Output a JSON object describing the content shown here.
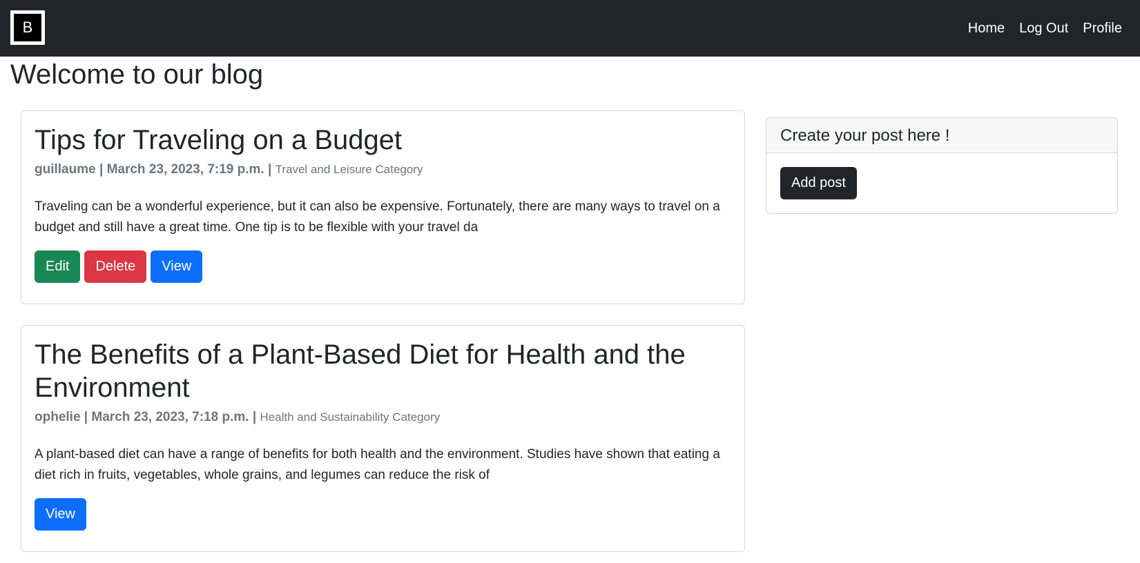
{
  "navbar": {
    "brand_letter": "B",
    "links": [
      "Home",
      "Log Out",
      "Profile"
    ]
  },
  "page": {
    "title": "Welcome to our blog"
  },
  "posts": [
    {
      "title": "Tips for Traveling on a Budget",
      "author": "guillaume",
      "date": "March 23, 2023, 7:19 p.m.",
      "separator": "|",
      "category": "Travel and Leisure Category",
      "excerpt": "Traveling can be a wonderful experience, but it can also be expensive. Fortunately, there are many ways to travel on a budget and still have a great time. One tip is to be flexible with your travel da",
      "buttons": {
        "edit": "Edit",
        "delete": "Delete",
        "view": "View"
      }
    },
    {
      "title": "The Benefits of a Plant-Based Diet for Health and the Environment",
      "author": "ophelie",
      "date": "March 23, 2023, 7:18 p.m.",
      "separator": "|",
      "category": "Health and Sustainability Category",
      "excerpt": "A plant-based diet can have a range of benefits for both health and the environment. Studies have shown that eating a diet rich in fruits, vegetables, whole grains, and legumes can reduce the risk of",
      "buttons": {
        "view": "View"
      }
    }
  ],
  "sidebar": {
    "header": "Create your post here !",
    "add_button": "Add post"
  },
  "colors": {
    "navbar": "#212529",
    "edit": "#198754",
    "delete": "#dc3545",
    "view": "#0d6efd",
    "dark_button": "#212529"
  }
}
